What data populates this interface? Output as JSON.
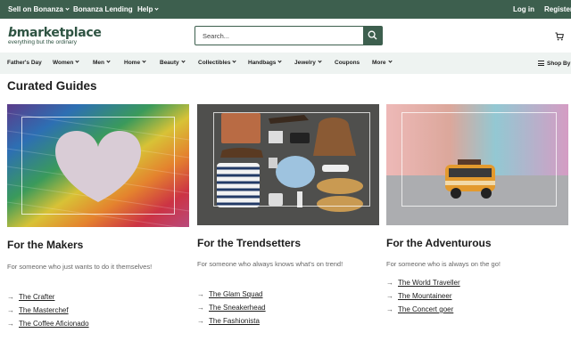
{
  "topbar": {
    "sell": "Sell on Bonanza",
    "lending": "Bonanza Lending",
    "help": "Help",
    "login": "Log in",
    "register": "Register"
  },
  "header": {
    "logo_main": "marketplace",
    "logo_b": "b",
    "logo_tagline": "everything but the ordinary",
    "search_placeholder": "Search..."
  },
  "nav": {
    "items": [
      "Father's Day",
      "Women",
      "Men",
      "Home",
      "Beauty",
      "Collectibles",
      "Handbags",
      "Jewelry",
      "Coupons",
      "More"
    ],
    "shop_by": "Shop By"
  },
  "main": {
    "title": "Curated Guides",
    "cards": [
      {
        "heading": "For the Makers",
        "description": "For someone who just wants to do it themselves!",
        "links": [
          "The Crafter",
          "The Masterchef",
          "The Coffee Aficionado"
        ]
      },
      {
        "heading": "For the Trendsetters",
        "description": "For someone who always knows what's on trend!",
        "links": [
          "The Glam Squad",
          "The Sneakerhead",
          "The Fashionista"
        ]
      },
      {
        "heading": "For the Adventurous",
        "description": "For someone who is always on the go!",
        "links": [
          "The World Traveller",
          "The Mountaineer",
          "The Concert goer"
        ]
      }
    ]
  },
  "colors": {
    "brand_green": "#3d5f4e",
    "nav_bg": "#eef3f1"
  },
  "icons": {
    "search": "search-icon",
    "cart": "cart-icon",
    "menu": "hamburger-icon",
    "link_arrow": "arrow-right-icon"
  }
}
